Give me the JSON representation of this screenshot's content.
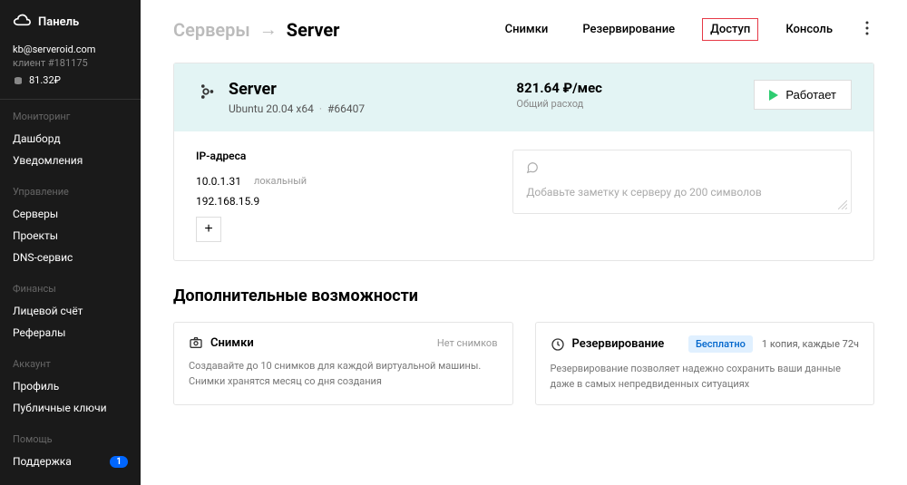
{
  "sidebar": {
    "title": "Панель",
    "email": "kb@serveroid.com",
    "client_label": "клиент #181175",
    "balance": "81.32₽",
    "sections": [
      {
        "title": "Мониторинг",
        "items": [
          "Дашборд",
          "Уведомления"
        ]
      },
      {
        "title": "Управление",
        "items": [
          "Серверы",
          "Проекты",
          "DNS-сервис"
        ]
      },
      {
        "title": "Финансы",
        "items": [
          "Лицевой счёт",
          "Рефералы"
        ]
      },
      {
        "title": "Аккаунт",
        "items": [
          "Профиль",
          "Публичные ключи"
        ]
      },
      {
        "title": "Помощь",
        "items": [
          "Поддержка"
        ],
        "badge": "1"
      }
    ]
  },
  "breadcrumb": {
    "parent": "Серверы",
    "current": "Server",
    "tabs": [
      "Снимки",
      "Резервирование",
      "Доступ",
      "Консоль"
    ],
    "active_tab": "Доступ"
  },
  "server": {
    "name": "Server",
    "os": "Ubuntu 20.04 x64",
    "id": "#66407",
    "price": "821.64 ₽/мес",
    "price_sub": "Общий расход",
    "status_label": "Работает",
    "ip_title": "IP-адреса",
    "ips": [
      {
        "addr": "10.0.1.31",
        "label": "локальный"
      },
      {
        "addr": "192.168.15.9",
        "label": ""
      }
    ],
    "note_placeholder": "Добавьте заметку к серверу до 200 символов"
  },
  "features": {
    "title": "Дополнительные возможности",
    "snapshots": {
      "title": "Снимки",
      "status": "Нет снимков",
      "desc": "Создавайте до 10 снимков для каждой виртуальной машины. Снимки хранятся месяц со дня создания"
    },
    "backup": {
      "title": "Резервирование",
      "badge": "Бесплатно",
      "schedule": "1 копия, каждые 72ч",
      "desc": "Резервирование позволяет надежно сохранить ваши данные даже в самых непредвиденных ситуациях"
    }
  }
}
